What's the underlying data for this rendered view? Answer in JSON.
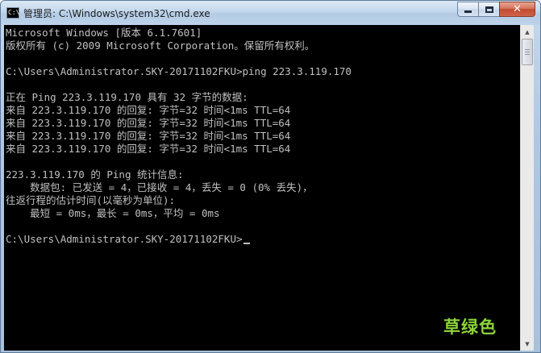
{
  "window": {
    "title": "管理员: C:\\Windows\\system32\\cmd.exe",
    "icon": "cmd-console-icon",
    "icon_glyph": "C:\\"
  },
  "caption_buttons": {
    "minimize_icon": "minimize-icon",
    "maximize_icon": "maximize-icon",
    "close_icon": "close-icon",
    "close_glyph": "✕"
  },
  "console": {
    "text_color": "#c0c0c0",
    "background": "#000000",
    "lines": [
      "Microsoft Windows [版本 6.1.7601]",
      "版权所有 (c) 2009 Microsoft Corporation。保留所有权利。",
      "",
      "C:\\Users\\Administrator.SKY-20171102FKU>ping 223.3.119.170",
      "",
      "正在 Ping 223.3.119.170 具有 32 字节的数据:",
      "来自 223.3.119.170 的回复: 字节=32 时间<1ms TTL=64",
      "来自 223.3.119.170 的回复: 字节=32 时间<1ms TTL=64",
      "来自 223.3.119.170 的回复: 字节=32 时间<1ms TTL=64",
      "来自 223.3.119.170 的回复: 字节=32 时间<1ms TTL=64",
      "",
      "223.3.119.170 的 Ping 统计信息:",
      "    数据包: 已发送 = 4，已接收 = 4，丢失 = 0 (0% 丢失)，",
      "往返行程的估计时间(以毫秒为单位):",
      "    最短 = 0ms，最长 = 0ms，平均 = 0ms",
      "",
      "C:\\Users\\Administrator.SKY-20171102FKU>"
    ]
  },
  "scrollbar": {
    "up_glyph": "▲",
    "down_glyph": "▼"
  },
  "watermark": {
    "text": "草绿色",
    "color": "#8bd43a"
  }
}
